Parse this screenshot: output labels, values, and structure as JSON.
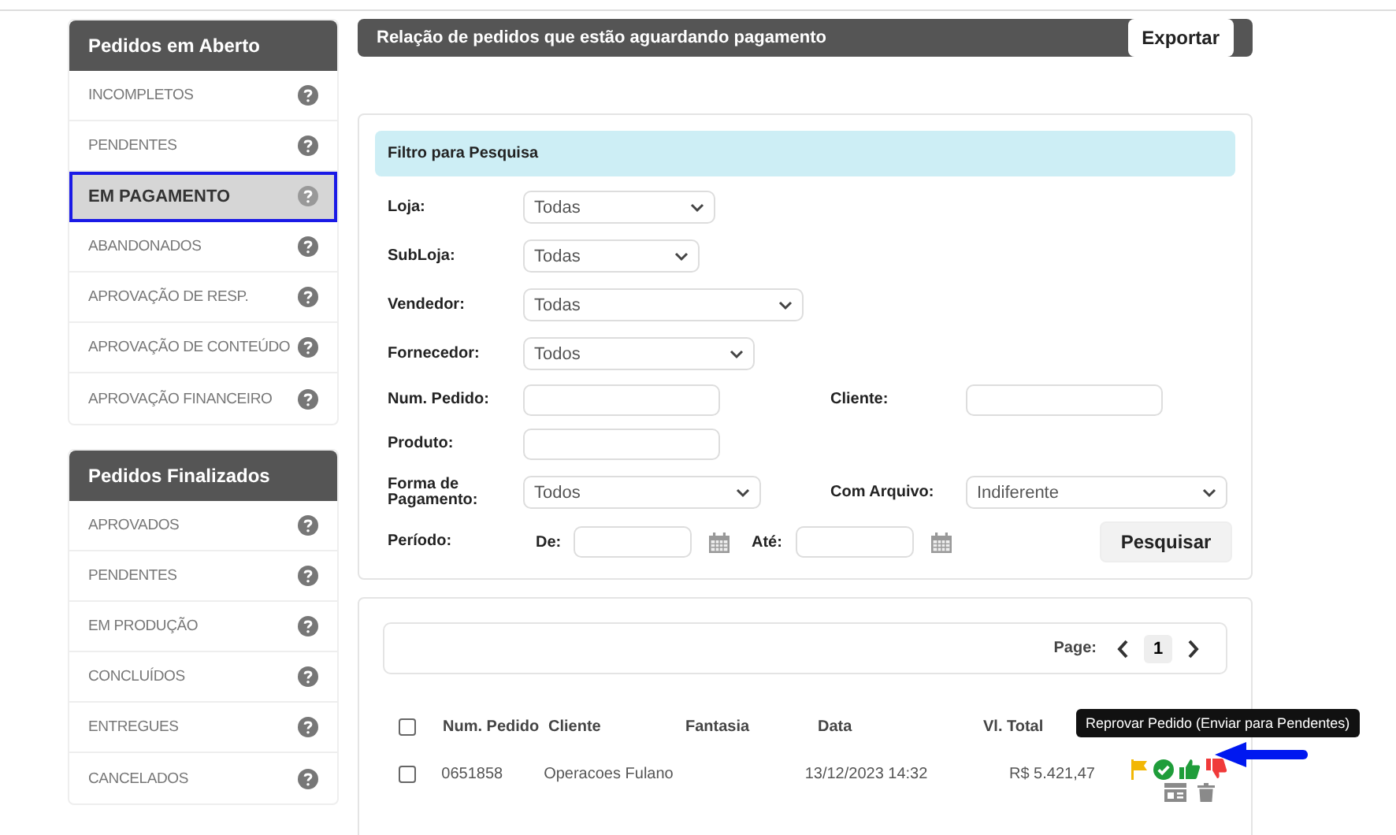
{
  "sidebar": [
    {
      "title": "Pedidos em Aberto",
      "items": [
        {
          "label": "INCOMPLETOS",
          "selected": false
        },
        {
          "label": "PENDENTES",
          "selected": false
        },
        {
          "label": "EM PAGAMENTO",
          "selected": true
        },
        {
          "label": "ABANDONADOS",
          "selected": false
        },
        {
          "label": "APROVAÇÃO DE RESP.",
          "selected": false
        },
        {
          "label": "APROVAÇÃO DE CONTEÚDO",
          "selected": false
        },
        {
          "label": "APROVAÇÃO FINANCEIRO",
          "selected": false
        }
      ]
    },
    {
      "title": "Pedidos Finalizados",
      "items": [
        {
          "label": "APROVADOS",
          "selected": false
        },
        {
          "label": "PENDENTES",
          "selected": false
        },
        {
          "label": "EM PRODUÇÃO",
          "selected": false
        },
        {
          "label": "CONCLUÍDOS",
          "selected": false
        },
        {
          "label": "ENTREGUES",
          "selected": false
        },
        {
          "label": "CANCELADOS",
          "selected": false
        }
      ]
    }
  ],
  "header": {
    "title": "Relação de pedidos que estão aguardando pagamento",
    "export_button": "Exportar"
  },
  "filter": {
    "title": "Filtro para Pesquisa",
    "rows": [
      [
        {
          "label": "Loja:",
          "kind": "select",
          "value": "Todas"
        }
      ],
      [
        {
          "label": "SubLoja:",
          "kind": "select",
          "value": "Todas"
        }
      ],
      [
        {
          "label": "Vendedor:",
          "kind": "select",
          "value": "Todas"
        }
      ],
      [
        {
          "label": "Fornecedor:",
          "kind": "select",
          "value": "Todos"
        }
      ],
      [
        {
          "label": "Num. Pedido:",
          "kind": "input"
        },
        {
          "label": "Cliente:",
          "kind": "input"
        }
      ],
      [
        {
          "label": "Produto:",
          "kind": "input"
        }
      ],
      [
        {
          "label": "Forma de Pagamento:",
          "kind": "select",
          "value": "Todos"
        },
        {
          "label": "Com Arquivo:",
          "kind": "select",
          "value": "Indiferente"
        }
      ]
    ],
    "period": {
      "label": "Período:",
      "from_label": "De:",
      "to_label": "Até:"
    },
    "search_button": "Pesquisar"
  },
  "pagination": {
    "label": "Page:",
    "current": "1"
  },
  "table": {
    "header_checked": false,
    "columns": [
      "Num. Pedido",
      "Cliente",
      "Fantasia",
      "Data",
      "Vl. Total"
    ],
    "rows": [
      {
        "checked": false,
        "number": "0651858",
        "client": "Operacoes Fulano",
        "date": "13/12/2023 14:32",
        "total": "R$ 5.421,47"
      }
    ]
  },
  "tooltip": "Reprovar Pedido (Enviar para Pendentes)"
}
